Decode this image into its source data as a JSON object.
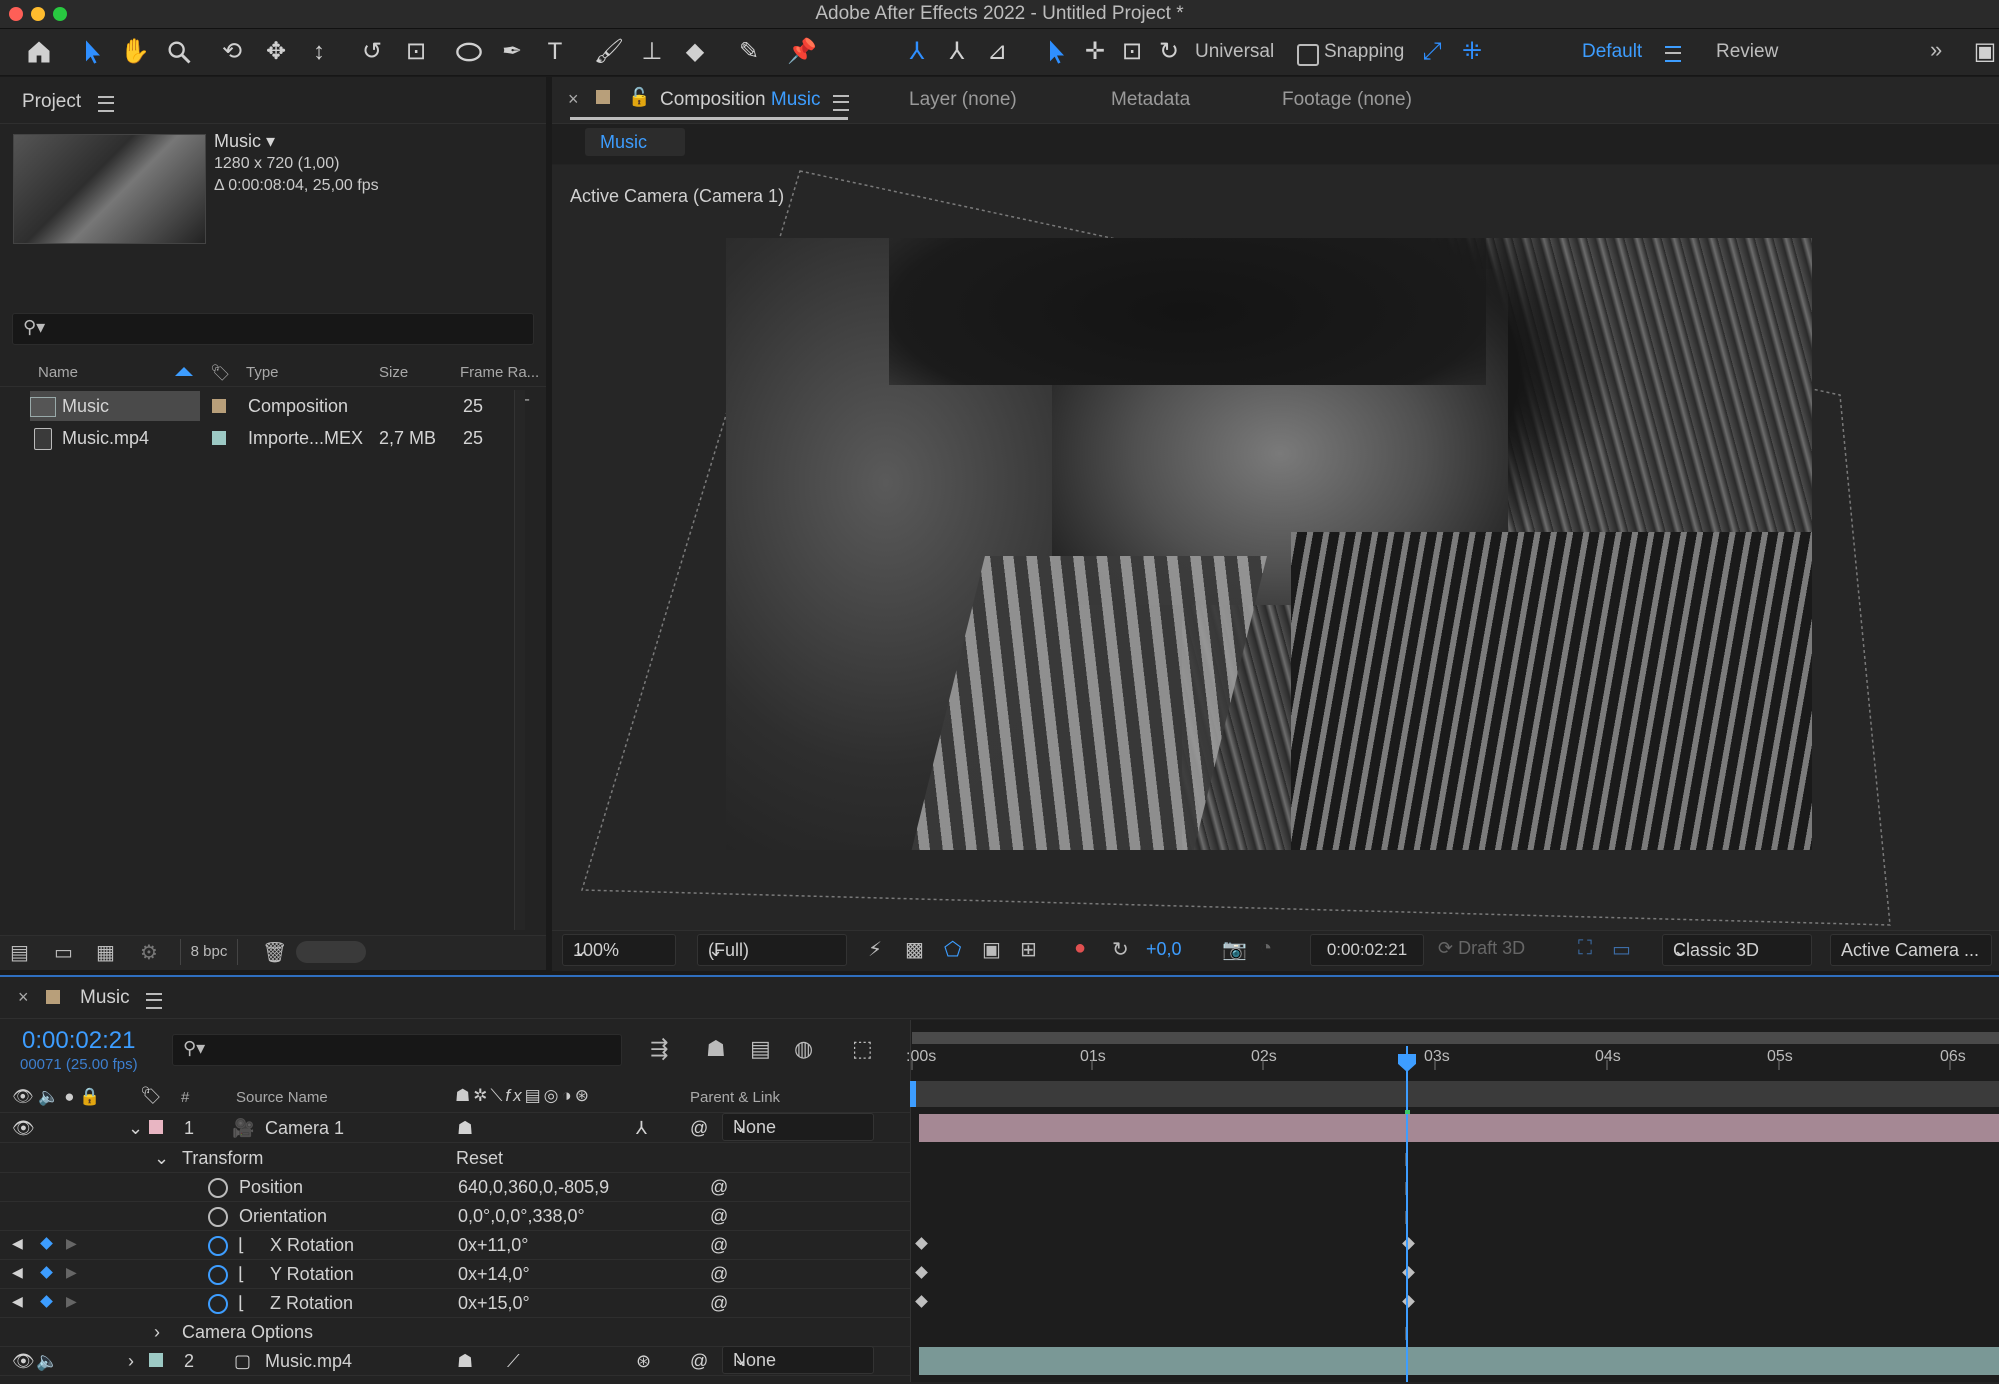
{
  "window": {
    "title": "Adobe After Effects 2022 - Untitled Project *"
  },
  "toolbar": {
    "universal_label": "Universal",
    "snapping_label": "Snapping",
    "workspaces": [
      "Default",
      "Review"
    ]
  },
  "project": {
    "panel_title": "Project",
    "selected_item": {
      "name": "Music",
      "resolution": "1280 x 720 (1,00)",
      "duration": "Δ 0:00:08:04, 25,00 fps"
    },
    "search_placeholder": "",
    "columns": [
      "Name",
      "Type",
      "Size",
      "Frame Ra..."
    ],
    "items": [
      {
        "name": "Music",
        "type": "Composition",
        "size": "",
        "frame_rate": "25",
        "label_color": "#b89f7a"
      },
      {
        "name": "Music.mp4",
        "type": "Importe...MEX",
        "size": "2,7 MB",
        "frame_rate": "25",
        "label_color": "#9cc9c4"
      }
    ],
    "bpc_label": "8 bpc"
  },
  "composition": {
    "tab_label": "Composition",
    "tab_comp_name": "Music",
    "other_tabs": [
      "Layer (none)",
      "Metadata",
      "Footage (none)"
    ],
    "breadcrumb": "Music",
    "camera_label": "Active Camera (Camera 1)",
    "zoom": "100%",
    "resolution": "(Full)",
    "exposure": "+0,0",
    "timecode": "0:00:02:21",
    "draft3d_label": "Draft 3D",
    "renderer": "Classic 3D",
    "view": "Active Camera ..."
  },
  "timeline": {
    "comp_name": "Music",
    "timecode": "0:00:02:21",
    "frame_info": "00071 (25.00 fps)",
    "columns": {
      "number": "#",
      "source_name": "Source Name",
      "parent": "Parent & Link"
    },
    "ruler": [
      ":00s",
      "01s",
      "02s",
      "03s",
      "04s",
      "05s",
      "06s"
    ],
    "layers": [
      {
        "index": "1",
        "name": "Camera 1",
        "parent": "None",
        "label_color": "#e8b5c2"
      },
      {
        "index": "2",
        "name": "Music.mp4",
        "parent": "None",
        "label_color": "#9cc9c4"
      }
    ],
    "transform": {
      "label": "Transform",
      "reset": "Reset",
      "properties": [
        {
          "name": "Position",
          "value": "640,0,360,0,-805,9"
        },
        {
          "name": "Orientation",
          "value": "0,0°,0,0°,338,0°"
        },
        {
          "name": "X Rotation",
          "value": "0x+11,0°"
        },
        {
          "name": "Y Rotation",
          "value": "0x+14,0°"
        },
        {
          "name": "Z Rotation",
          "value": "0x+15,0°"
        }
      ]
    },
    "camera_options_label": "Camera Options"
  }
}
